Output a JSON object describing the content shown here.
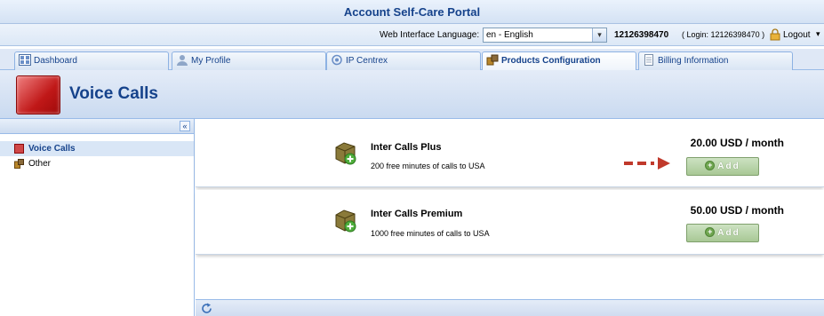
{
  "app": {
    "title": "Account Self-Care Portal"
  },
  "lang_bar": {
    "label": "Web Interface Language:",
    "selected_language": "en - English",
    "account_id": "12126398470",
    "login_info": "( Login: 12126398470 )",
    "logout_label": "Logout"
  },
  "tabs": [
    {
      "label": "Dashboard",
      "icon": "dashboard-icon",
      "active": false
    },
    {
      "label": "My Profile",
      "icon": "user-profile-icon",
      "active": false
    },
    {
      "label": "IP Centrex",
      "icon": "ip-centrex-icon",
      "active": false
    },
    {
      "label": "Products Configuration",
      "icon": "products-icon",
      "active": true
    },
    {
      "label": "Billing Information",
      "icon": "billing-document-icon",
      "active": false
    }
  ],
  "header": {
    "title": "Voice Calls"
  },
  "sidebar": {
    "items": [
      {
        "label": "Voice Calls",
        "selected": true
      },
      {
        "label": "Other",
        "selected": false
      }
    ]
  },
  "products": [
    {
      "name": "Inter Calls Plus",
      "description": "200 free minutes of calls to USA",
      "price": "20.00 USD / month",
      "button_label": "Add"
    },
    {
      "name": "Inter Calls Premium",
      "description": "1000 free minutes of calls to USA",
      "price": "50.00 USD / month",
      "button_label": "Add"
    }
  ],
  "colors": {
    "accent": "#15428b",
    "add_button": "#a8c895",
    "annotation_arrow": "#c0392b"
  }
}
